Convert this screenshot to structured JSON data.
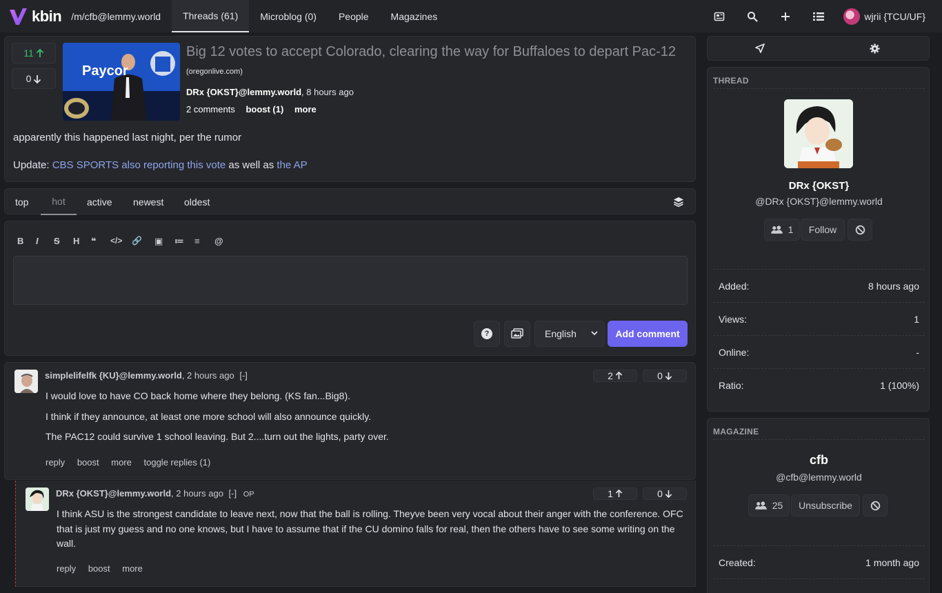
{
  "topbar": {
    "brand": "kbin",
    "magazine_path": "/m/cfb@lemmy.world",
    "tabs": [
      {
        "label": "Threads (61)"
      },
      {
        "label": "Microblog (0)"
      },
      {
        "label": "People"
      },
      {
        "label": "Magazines"
      }
    ],
    "user": "wjrii {TCU/UF}"
  },
  "thread": {
    "upvotes": "11",
    "downvotes": "0",
    "title": "Big 12 votes to accept Colorado, clearing the way for Buffaloes to depart Pac-12",
    "domain": "(oregonlive.com)",
    "author": "DRx {OKST}@lemmy.world",
    "time": ", 8 hours ago",
    "comments": "2 comments",
    "boost": "boost (1)",
    "more": "more",
    "body_line1": "apparently this happened last night, per the rumor",
    "update_prefix": "Update: ",
    "link1": "CBS SPORTS also reporting this vote",
    "middle": " as well as ",
    "link2": "the AP",
    "thumb_text": "Paycor"
  },
  "sort": {
    "tabs": [
      "top",
      "hot",
      "active",
      "newest",
      "oldest"
    ]
  },
  "editor": {
    "toolbar": [
      "B",
      "I",
      "S",
      "H",
      "❝",
      "</>",
      "🔗",
      "▣",
      "≔",
      "≡",
      "@"
    ],
    "language": "English",
    "submit": "Add comment"
  },
  "comments": [
    {
      "author": "simplelifelfk {KU}@lemmy.world",
      "time": ", 2 hours ago",
      "collapse": "[-]",
      "up": "2",
      "down": "0",
      "paragraphs": [
        "I would love to have CO back home where they belong. (KS fan...Big8).",
        "I think if they announce, at least one more school will also announce quickly.",
        "The PAC12 could survive 1 school leaving. But 2....turn out the lights, party over."
      ],
      "actions": [
        "reply",
        "boost",
        "more",
        "toggle replies (1)"
      ]
    },
    {
      "author": "DRx {OKST}@lemmy.world",
      "time": ", 2 hours ago",
      "collapse": "[-]",
      "op": "OP",
      "up": "1",
      "down": "0",
      "paragraphs": [
        "I think ASU is the strongest candidate to leave next, now that the ball is rolling. Theyve been very vocal about their anger with the conference. OFC that is just my guess and no one knows, but I have to assume that if the CU domino falls for real, then the others have to see some writing on the wall."
      ],
      "actions": [
        "reply",
        "boost",
        "more"
      ]
    }
  ],
  "sidebar": {
    "thread_heading": "THREAD",
    "thread_user": "DRx {OKST}",
    "thread_handle": "@DRx {OKST}@lemmy.world",
    "followers": "1",
    "follow": "Follow",
    "stats": [
      {
        "label": "Added:",
        "value": "8 hours ago"
      },
      {
        "label": "Views:",
        "value": "1"
      },
      {
        "label": "Online:",
        "value": "-"
      },
      {
        "label": "Ratio:",
        "value": "1 (100%)"
      }
    ],
    "magazine_heading": "MAGAZINE",
    "magazine_name": "cfb",
    "magazine_handle": "@cfb@lemmy.world",
    "subscribers": "25",
    "unsubscribe": "Unsubscribe",
    "created_label": "Created:",
    "created_value": "1 month ago"
  }
}
